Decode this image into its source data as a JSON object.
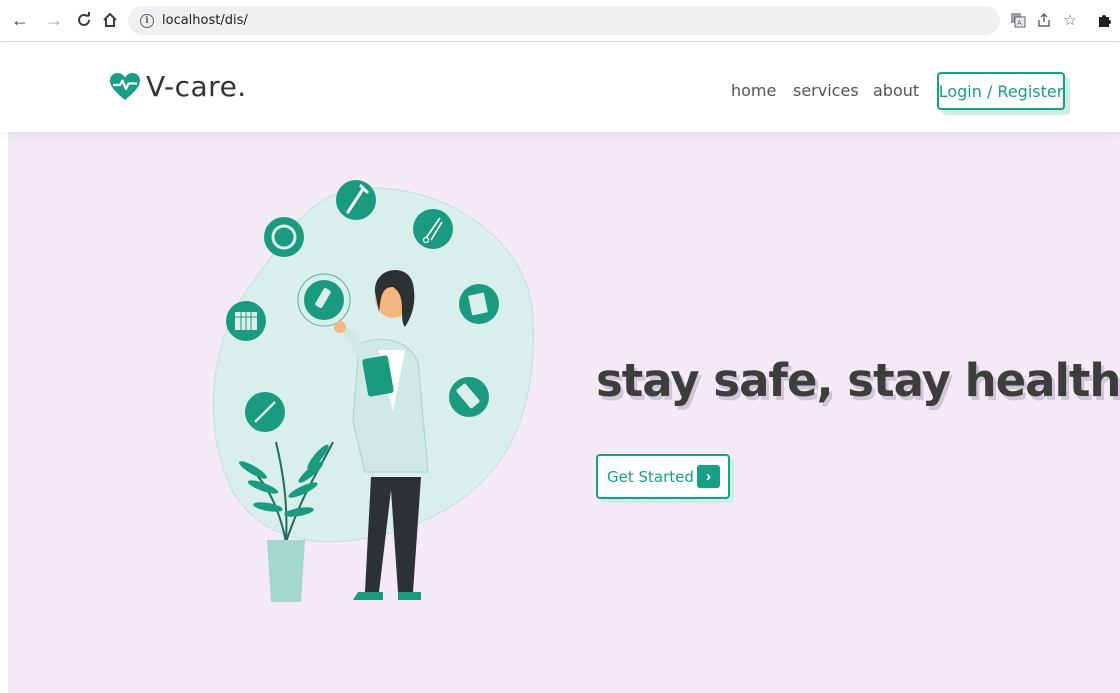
{
  "browser": {
    "url": "localhost/dis/",
    "back_icon": "arrow-left",
    "forward_icon": "arrow-right",
    "reload_icon": "reload",
    "home_icon": "home",
    "translate_icon": "translate",
    "share_icon": "share",
    "bookmark_icon": "star",
    "extensions_icon": "puzzle"
  },
  "header": {
    "logo_text": "V-care.",
    "nav": {
      "home": "home",
      "services": "services",
      "about": "about"
    },
    "login_label": "Login / Register"
  },
  "hero": {
    "title": "stay safe, stay healthy",
    "cta_label": "Get Started"
  },
  "colors": {
    "accent": "#17a086",
    "hero_bg": "#f3eaf6",
    "title": "#3d3d3d"
  }
}
